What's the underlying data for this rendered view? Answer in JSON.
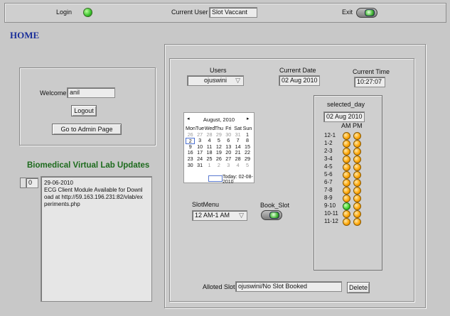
{
  "topbar": {
    "login_label": "Login",
    "current_user_label": "Current User",
    "current_user_value": "Slot Vaccant",
    "exit_label": "Exit"
  },
  "home_title": "HOME",
  "welcome": {
    "label": "Welcome",
    "value": "anil",
    "logout": "Logout",
    "admin": "Go to Admin Page"
  },
  "updates": {
    "title": "Biomedical Virtual Lab Updates",
    "index": "0",
    "date": "29-06-2010",
    "text": "ECG Client Module Available for Download at http://59.163.196.231:82/vlab/experiments.php"
  },
  "users": {
    "label": "Users",
    "selected": "ojuswini"
  },
  "current_date": {
    "label": "Current Date",
    "value": "02 Aug 2010"
  },
  "current_time": {
    "label": "Current Time",
    "value": "10:27:07"
  },
  "calendar": {
    "month": "August, 2010",
    "weekdays": [
      "Mon",
      "Tue",
      "Wed",
      "Thu",
      "Fri",
      "Sat",
      "Sun"
    ],
    "weeks": [
      [
        "26",
        "27",
        "28",
        "29",
        "30",
        "31",
        "1"
      ],
      [
        "2",
        "3",
        "4",
        "5",
        "6",
        "7",
        "8"
      ],
      [
        "9",
        "10",
        "11",
        "12",
        "13",
        "14",
        "15"
      ],
      [
        "16",
        "17",
        "18",
        "19",
        "20",
        "21",
        "22"
      ],
      [
        "23",
        "24",
        "25",
        "26",
        "27",
        "28",
        "29"
      ],
      [
        "30",
        "31",
        "1",
        "2",
        "3",
        "4",
        "5"
      ]
    ],
    "today": "Today: 02-08-2010"
  },
  "slot": {
    "label": "SlotMenu",
    "selected": "12 AM-1 AM",
    "book_label": "Book_Slot"
  },
  "selected_day": {
    "label": "selected_day",
    "value": "02 Aug 2010",
    "am": "AM",
    "pm": "PM",
    "hours": [
      "12-1",
      "1-2",
      "2-3",
      "3-4",
      "4-5",
      "5-6",
      "6-7",
      "7-8",
      "8-9",
      "9-10",
      "10-11",
      "11-12"
    ],
    "am_green_index": 9
  },
  "alloted": {
    "label": "Alloted Slot",
    "value": "ojuswini/No Slot Booked",
    "delete": "Delete"
  },
  "colors": {
    "led_on": "#38c12a",
    "slot_available": "#ffa400",
    "slot_booked": "#3ed22a",
    "home_title": "#1a2f9a",
    "updates_title": "#1d6b1d"
  }
}
